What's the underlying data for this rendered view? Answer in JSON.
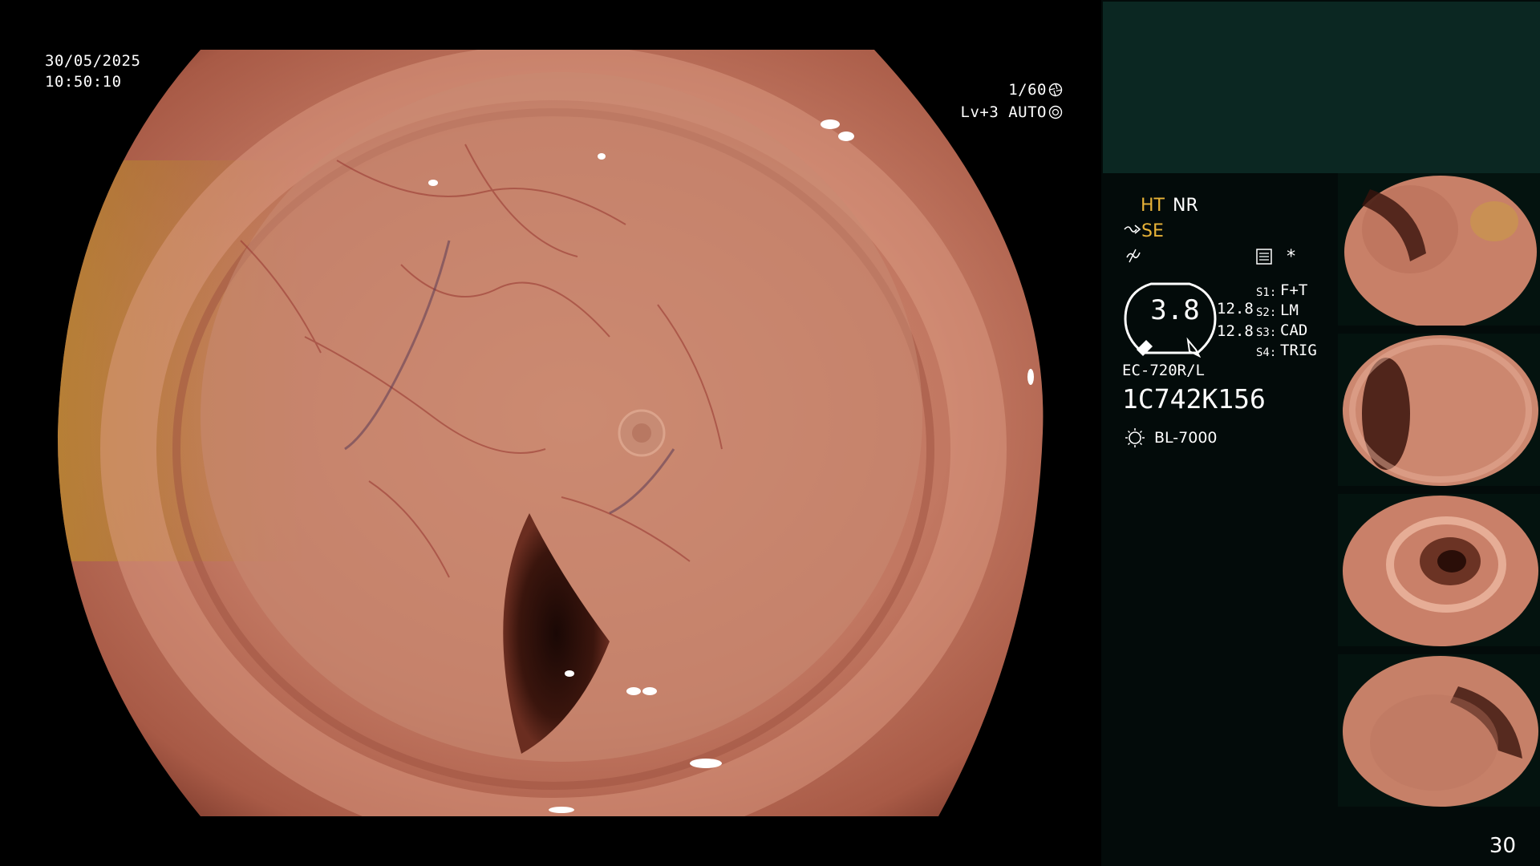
{
  "scope": {
    "date": "30/05/2025",
    "time": "10:50:10",
    "shutter": "1/60",
    "exposure": "Lv+3 AUTO"
  },
  "panel": {
    "ht": "HT",
    "nr": "NR",
    "se": "SE",
    "star": "*",
    "gauge_value": "3.8",
    "value_a": "12.8",
    "value_b": "12.8",
    "switches": [
      {
        "label": "S1:",
        "value": "F+T"
      },
      {
        "label": "S2:",
        "value": "LM"
      },
      {
        "label": "S3:",
        "value": "CAD"
      },
      {
        "label": "S4:",
        "value": "TRIG"
      }
    ],
    "scope_model": "EC-720R/L",
    "scope_serial": "1C742K156",
    "light_source": "BL-7000",
    "accent_color": "#e8b338",
    "header_color": "#0b2722"
  },
  "page_number": "30"
}
